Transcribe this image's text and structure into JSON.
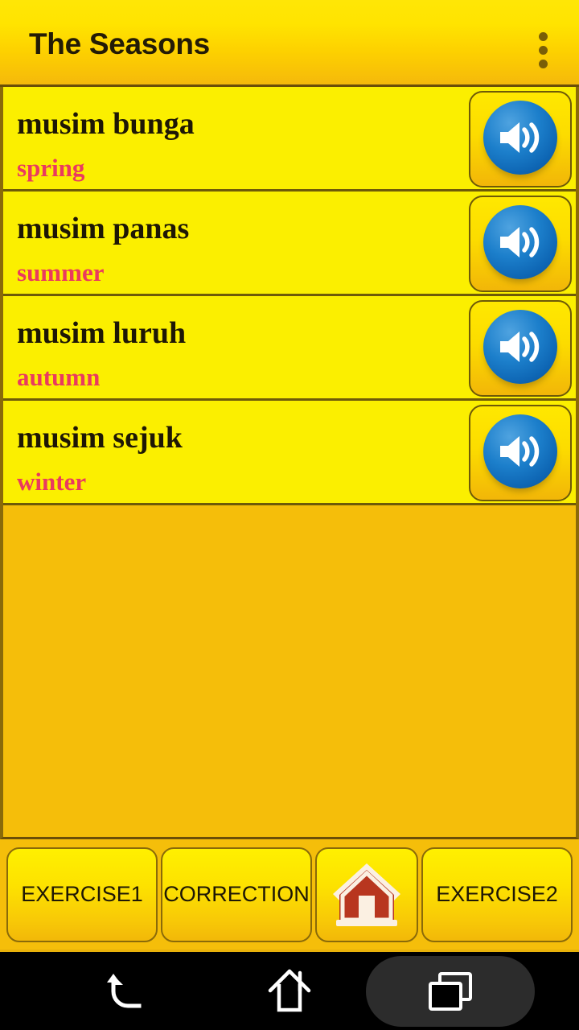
{
  "titlebar": {
    "title": "The Seasons",
    "overflow_icon": "more-vertical-icon"
  },
  "colors": {
    "row_background": "#FBEF00",
    "page_background": "#F5BE0A",
    "term_text": "#1E1705",
    "translation_text": "#EA3A5F",
    "border": "#6E5A08",
    "speaker_blue": "#1C7FCB",
    "home_red": "#B8361F"
  },
  "list": {
    "items": [
      {
        "term": "musim bunga",
        "translation": "spring",
        "speaker_icon": "speaker-volume-icon"
      },
      {
        "term": "musim panas",
        "translation": "summer",
        "speaker_icon": "speaker-volume-icon"
      },
      {
        "term": "musim luruh",
        "translation": "autumn",
        "speaker_icon": "speaker-volume-icon"
      },
      {
        "term": "musim sejuk",
        "translation": "winter",
        "speaker_icon": "speaker-volume-icon"
      }
    ]
  },
  "bottombar": {
    "buttons": [
      {
        "label": "EXERCISE1",
        "icon": ""
      },
      {
        "label": "CORRECTION",
        "icon": ""
      },
      {
        "label": "",
        "icon": "home-house-icon"
      },
      {
        "label": "EXERCISE2",
        "icon": ""
      }
    ]
  },
  "sysnav": {
    "back_icon": "back-arrow-icon",
    "home_icon": "home-outline-icon",
    "recents_icon": "recent-apps-icon"
  }
}
